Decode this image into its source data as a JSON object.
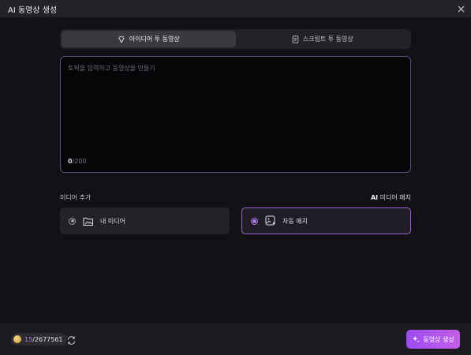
{
  "window": {
    "title": "AI 동영상 생성",
    "close_icon": "close-icon"
  },
  "tabs": [
    {
      "label": "아이디어 투 동영상",
      "icon": "lightbulb-icon",
      "active": true
    },
    {
      "label": "스크립트 투 동영상",
      "icon": "document-icon",
      "active": false
    }
  ],
  "prompt": {
    "placeholder": "토픽을 입력하고 동영상을 만들기",
    "value": "",
    "count": "0",
    "max": "/200"
  },
  "media": {
    "section_label": "미디어 추가",
    "ai_label_prefix": "AI",
    "ai_label_suffix": " 미디어 매치",
    "options": [
      {
        "label": "내 미디어",
        "icon": "folder-image-icon",
        "selected": false
      },
      {
        "label": "자동 매치",
        "icon": "image-sparkle-icon",
        "selected": true
      }
    ]
  },
  "footer": {
    "credits_used": "15",
    "credits_total": "/2677561",
    "refresh_icon": "refresh-icon",
    "generate_label": "동영상 생성",
    "generate_icon": "sparkle-icon"
  },
  "colors": {
    "accent": "#b07be8",
    "generate_gradient_start": "#9c4cf0",
    "generate_gradient_end": "#c35ee6"
  }
}
